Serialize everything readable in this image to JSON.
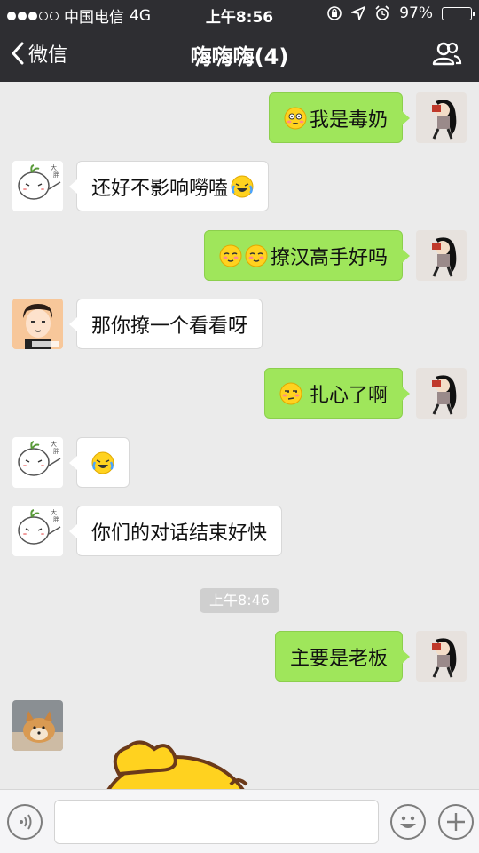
{
  "status_bar": {
    "carrier": "中国电信",
    "network": "4G",
    "time": "上午8:56",
    "battery": "97%",
    "battery_level": 0.97
  },
  "nav": {
    "back_label": "微信",
    "title": "嗨嗨嗨(4)",
    "contacts_icon": "group-contacts-icon"
  },
  "messages": [
    {
      "side": "right",
      "text": "我是毒奶",
      "emojis": [
        "flushed-emoji"
      ]
    },
    {
      "side": "left",
      "text": "还好不影响嘮嗑",
      "emojis_after": [
        "laughing-crying-emoji"
      ]
    },
    {
      "side": "right",
      "text": "撩汉高手好吗",
      "emojis": [
        "smirk-emoji",
        "smirk-emoji"
      ]
    },
    {
      "side": "left",
      "text": "那你撩一个看看呀"
    },
    {
      "side": "right",
      "text": "扎心了啊",
      "emojis": [
        "unamused-emoji"
      ]
    },
    {
      "side": "left",
      "text": "",
      "emojis": [
        "laughing-crying-emoji"
      ]
    },
    {
      "side": "left",
      "text": "你们的对话结束好快"
    },
    {
      "side": "right",
      "text": "主要是老板"
    }
  ],
  "timestamp": "上午8:46",
  "colors": {
    "header_bg": "#2e2e32",
    "chat_bg": "#ebebeb",
    "sent_bubble": "#9fe65b",
    "received_bubble": "#ffffff",
    "sticker_yellow": "#ffd21f"
  }
}
